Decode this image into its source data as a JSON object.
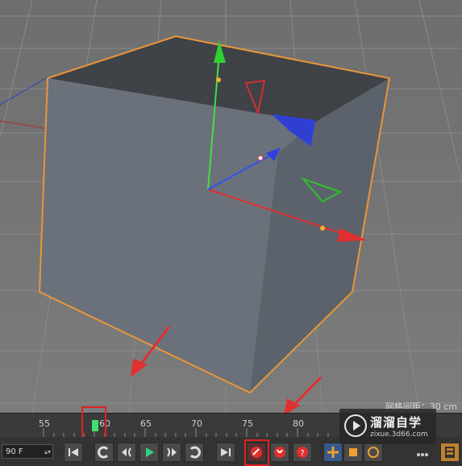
{
  "viewport": {
    "grid_spacing_label": "网格间距：30 cm"
  },
  "timeline": {
    "tick_labels": [
      "55",
      "60",
      "65",
      "70",
      "75",
      "80"
    ],
    "current_frame_marker": "60"
  },
  "transport": {
    "end_frame_value": "90 F",
    "buttons": [
      "goto-start-icon",
      "previous-key-icon",
      "previous-frame-icon",
      "play-icon",
      "next-frame-icon",
      "next-key-icon",
      "goto-end-icon",
      "record-keyframe-icon",
      "auto-keyframe-icon",
      "keyframe-selection-icon",
      "move-key-icon",
      "scale-key-icon",
      "rotate-key-icon",
      "more-icon",
      "timeline-icon"
    ]
  },
  "watermark": {
    "title": "溜溜自学",
    "subtitle": "zixue.3d66.com"
  },
  "colors": {
    "highlight_box": "#e02020",
    "object_outline": "#e8963a",
    "axis_x": "#e03030",
    "axis_y": "#30d030",
    "axis_z": "#3030e0",
    "play": "#30d080"
  }
}
